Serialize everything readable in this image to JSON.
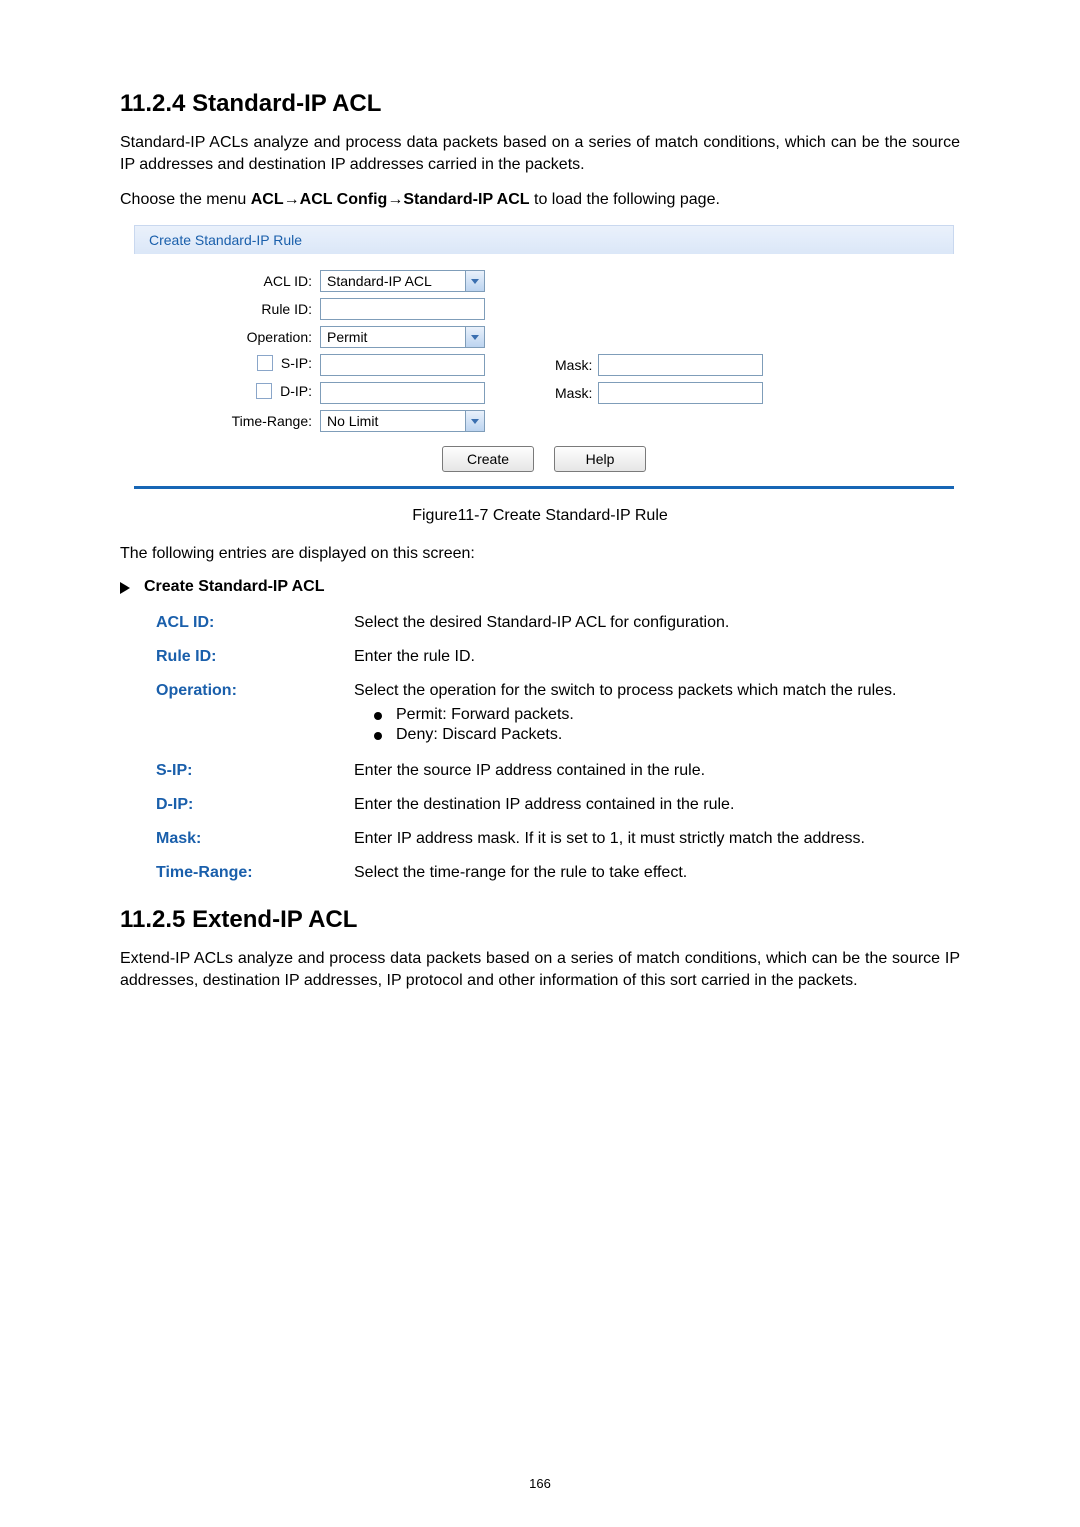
{
  "section1": {
    "heading": "11.2.4  Standard-IP ACL",
    "intro": "Standard-IP ACLs analyze and process data packets based on a series of match conditions, which can be the source IP addresses and destination IP addresses carried in the packets.",
    "menu_pre": "Choose the menu ",
    "menu_bold": "ACL→ACL Config→Standard-IP ACL",
    "menu_post": " to load the following page."
  },
  "panel": {
    "header": "Create Standard-IP Rule",
    "labels": {
      "acl_id": "ACL ID:",
      "rule_id": "Rule ID:",
      "operation": "Operation:",
      "sip": "S-IP:",
      "dip": "D-IP:",
      "mask": "Mask:",
      "time_range": "Time-Range:"
    },
    "acl_id_value": "Standard-IP ACL",
    "operation_value": "Permit",
    "time_range_value": "No Limit",
    "buttons": {
      "create": "Create",
      "help": "Help"
    }
  },
  "figure_caption": "Figure11-7 Create Standard-IP Rule",
  "entries_sentence": "The following entries are displayed on this screen:",
  "entries_title": "Create Standard-IP ACL",
  "defs": {
    "acl_id": {
      "label": "ACL ID:",
      "desc": "Select the desired Standard-IP ACL for configuration."
    },
    "rule_id": {
      "label": "Rule ID:",
      "desc": "Enter the rule ID."
    },
    "operation": {
      "label": "Operation:",
      "desc": "Select the operation for the switch to process packets which match the rules.",
      "items": [
        "Permit: Forward packets.",
        "Deny: Discard Packets."
      ]
    },
    "sip": {
      "label": "S-IP:",
      "desc": "Enter the source IP address contained in the rule."
    },
    "dip": {
      "label": "D-IP:",
      "desc": "Enter the destination IP address contained in the rule."
    },
    "mask": {
      "label": "Mask:",
      "desc": "Enter IP address mask. If it is set to 1, it must strictly match the address."
    },
    "time_range": {
      "label": "Time-Range:",
      "desc": "Select the time-range for the rule to take effect."
    }
  },
  "section2": {
    "heading": "11.2.5  Extend-IP ACL",
    "intro": "Extend-IP ACLs analyze and process data packets based on a series of match conditions, which can be the source IP addresses, destination IP addresses, IP protocol and other information of this sort carried in the packets."
  },
  "page_number": "166"
}
